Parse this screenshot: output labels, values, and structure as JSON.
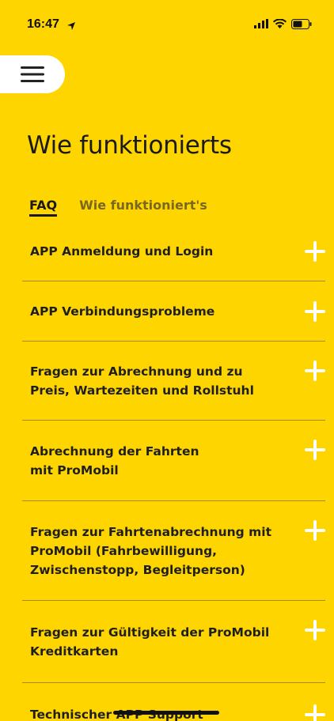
{
  "status": {
    "time": "16:47"
  },
  "header": {
    "title": "Wie funktionierts"
  },
  "tabs": [
    {
      "label": "FAQ",
      "active": true
    },
    {
      "label": "Wie funktioniert's",
      "active": false
    }
  ],
  "faq": [
    {
      "label": "APP Anmeldung und Login"
    },
    {
      "label": "APP Verbindungsprobleme"
    },
    {
      "label": "Fragen zur Abrechnung und zu Preis, Wartezeiten und Rollstuhl"
    },
    {
      "label": "Abrechnung der Fahrten mit ProMobil"
    },
    {
      "label": "Fragen zur Fahrtenabrechnung mit ProMobil (Fahrbewilligung, Zwischenstopp, Begleitperson)"
    },
    {
      "label": "Fragen zur Gültigkeit der ProMobil Kreditkarten"
    },
    {
      "label": "Technischer APP Support"
    }
  ],
  "colors": {
    "background": "#FFD500",
    "plus": "#FFFFFF",
    "text": "#1A1A1A"
  },
  "icons": {
    "menu": "hamburger-icon",
    "expand": "plus-icon"
  }
}
